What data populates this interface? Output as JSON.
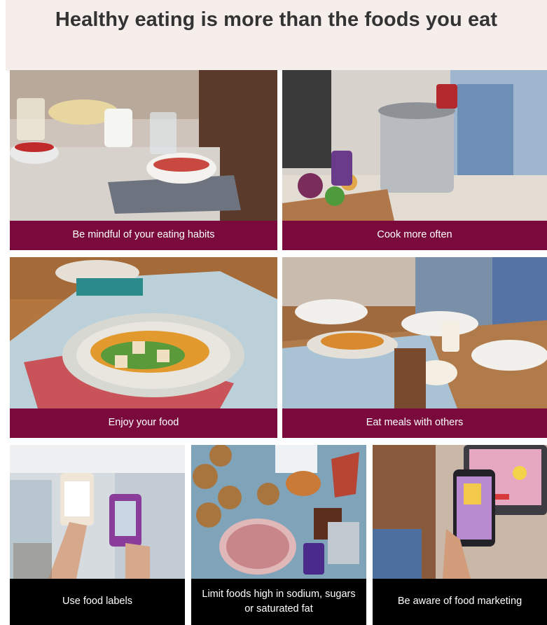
{
  "header": {
    "title": "Healthy eating is more than the foods you eat"
  },
  "colors": {
    "caption_maroon": "#7a0a3c",
    "caption_black": "#000000",
    "header_band": "#f5eeea",
    "title_text": "#333333"
  },
  "cards": [
    {
      "label": "Be mindful of your eating habits",
      "icon": "breakfast-table-photo"
    },
    {
      "label": "Cook more often",
      "icon": "cooking-pot-photo"
    },
    {
      "label": "Enjoy your food",
      "icon": "plated-meal-photo"
    },
    {
      "label": "Eat meals with others",
      "icon": "shared-meal-photo"
    },
    {
      "label": "Use food labels",
      "icon": "food-can-labels-photo"
    },
    {
      "label": "Limit foods high in sodium, sugars or saturated fat",
      "icon": "junk-food-photo"
    },
    {
      "label": "Be aware of food marketing",
      "icon": "phone-ad-photo"
    }
  ]
}
